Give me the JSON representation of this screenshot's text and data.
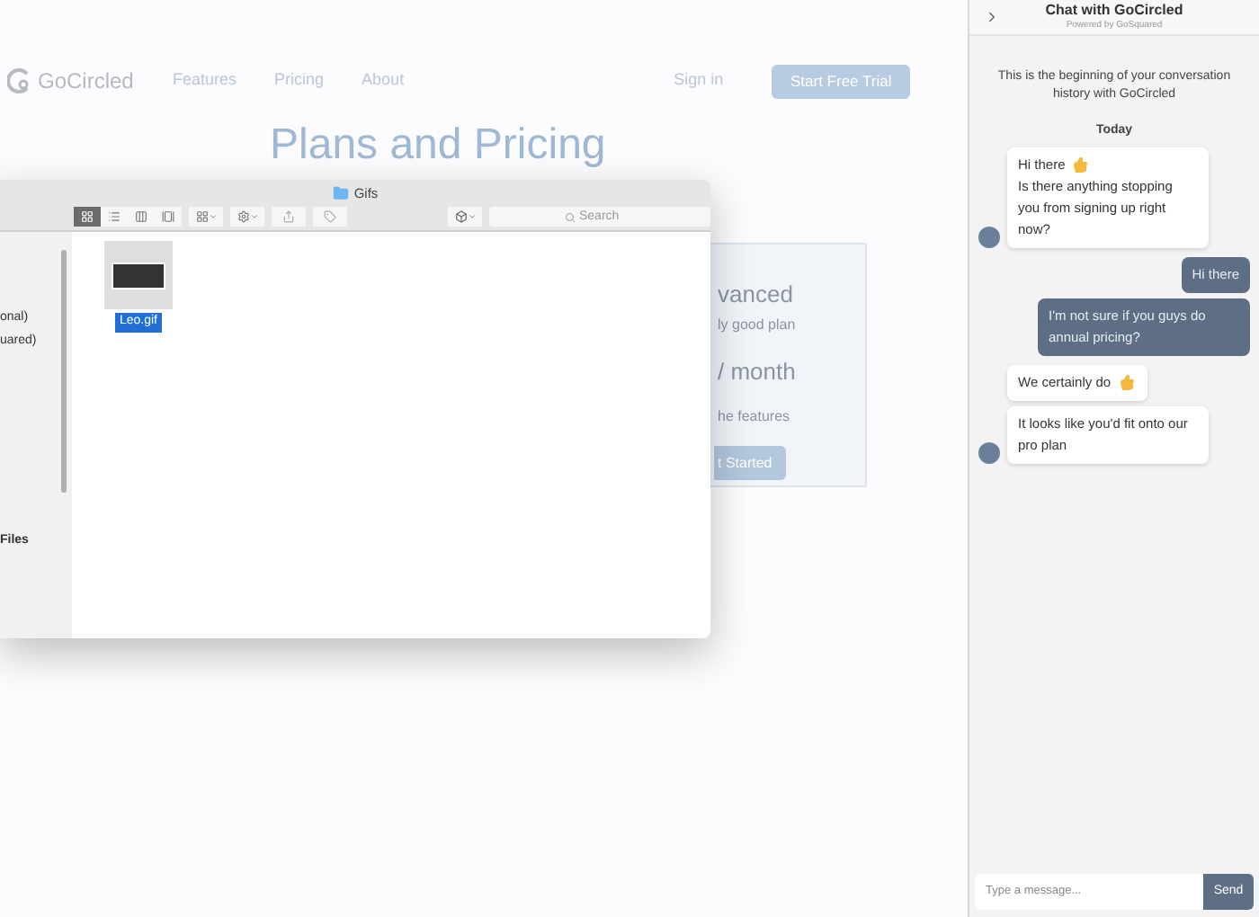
{
  "nav": {
    "logo": "GoCircled",
    "links": [
      {
        "label": "Features"
      },
      {
        "label": "Pricing"
      },
      {
        "label": "About"
      }
    ],
    "sign_in": "Sign in",
    "cta": "Start Free Trial"
  },
  "page_title": "Plans and Pricing",
  "plan_card": {
    "name": "vanced",
    "tagline": "ly good plan",
    "price": "/ month",
    "feature": "he features",
    "button": "t Started"
  },
  "finder": {
    "title": "Gifs",
    "view_modes": [
      {
        "selected": true
      },
      {
        "selected": false
      },
      {
        "selected": false
      },
      {
        "selected": false
      }
    ],
    "search_placeholder": "Search",
    "sidebar_items": [
      "onal)",
      "uared)",
      "Files"
    ],
    "files": [
      {
        "name": "Leo.gif",
        "selected": true
      }
    ]
  },
  "chat": {
    "title": "Chat with GoCircled",
    "subtitle": "Powered by GoSquared",
    "intro": "This is the beginning of your conversation history with GoCircled",
    "day": "Today",
    "groups": [
      {
        "kind": "agent",
        "bubbles": [
          {
            "lines": [
              {
                "text": "Hi there",
                "hand": true
              },
              {
                "text": "Is there anything stopping you from signing up right now?",
                "hand": false
              }
            ]
          }
        ]
      },
      {
        "kind": "visitor",
        "bubbles": [
          {
            "lines": [
              {
                "text": "Hi there",
                "hand": false
              }
            ]
          },
          {
            "lines": [
              {
                "text": "I'm not sure if you guys do annual pricing?",
                "hand": false
              }
            ]
          }
        ]
      },
      {
        "kind": "agent",
        "bubbles": [
          {
            "lines": [
              {
                "text": "We certainly do",
                "hand": true
              }
            ]
          },
          {
            "lines": [
              {
                "text": "It looks like you'd fit onto our pro plan",
                "hand": false
              }
            ]
          }
        ]
      }
    ],
    "input_placeholder": "Type a message...",
    "send": "Send"
  }
}
